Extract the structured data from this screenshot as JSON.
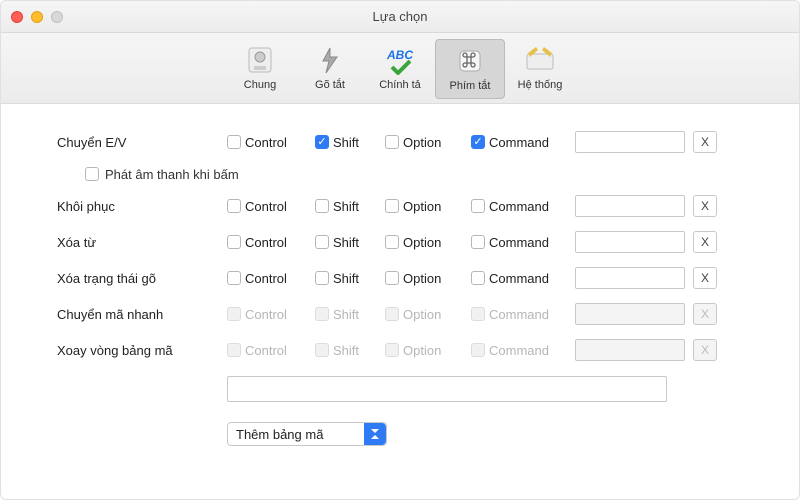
{
  "window": {
    "title": "Lựa chọn"
  },
  "toolbar": {
    "tabs": [
      {
        "label": "Chung"
      },
      {
        "label": "Gõ tắt"
      },
      {
        "label": "Chính tả"
      },
      {
        "label": "Phím tắt"
      },
      {
        "label": "Hệ thống"
      }
    ],
    "active_index": 3
  },
  "modifiers": {
    "control": "Control",
    "shift": "Shift",
    "option": "Option",
    "command": "Command"
  },
  "shortcuts": [
    {
      "label": "Chuyển E/V",
      "control": false,
      "shift": true,
      "option": false,
      "command": true,
      "key": "",
      "clear": "X",
      "disabled": false,
      "sound_checkbox": {
        "checked": false,
        "label": "Phát âm thanh khi bấm"
      }
    },
    {
      "label": "Khôi phục",
      "control": false,
      "shift": false,
      "option": false,
      "command": false,
      "key": "",
      "clear": "X",
      "disabled": false
    },
    {
      "label": "Xóa từ",
      "control": false,
      "shift": false,
      "option": false,
      "command": false,
      "key": "",
      "clear": "X",
      "disabled": false
    },
    {
      "label": "Xóa trạng thái gõ",
      "control": false,
      "shift": false,
      "option": false,
      "command": false,
      "key": "",
      "clear": "X",
      "disabled": false
    },
    {
      "label": "Chuyển mã nhanh",
      "control": false,
      "shift": false,
      "option": false,
      "command": false,
      "key": "",
      "clear": "X",
      "disabled": true
    },
    {
      "label": "Xoay vòng bảng mã",
      "control": false,
      "shift": false,
      "option": false,
      "command": false,
      "key": "",
      "clear": "X",
      "disabled": true
    }
  ],
  "extra_input": {
    "value": ""
  },
  "dropdown": {
    "selected": "Thêm bảng mã"
  }
}
